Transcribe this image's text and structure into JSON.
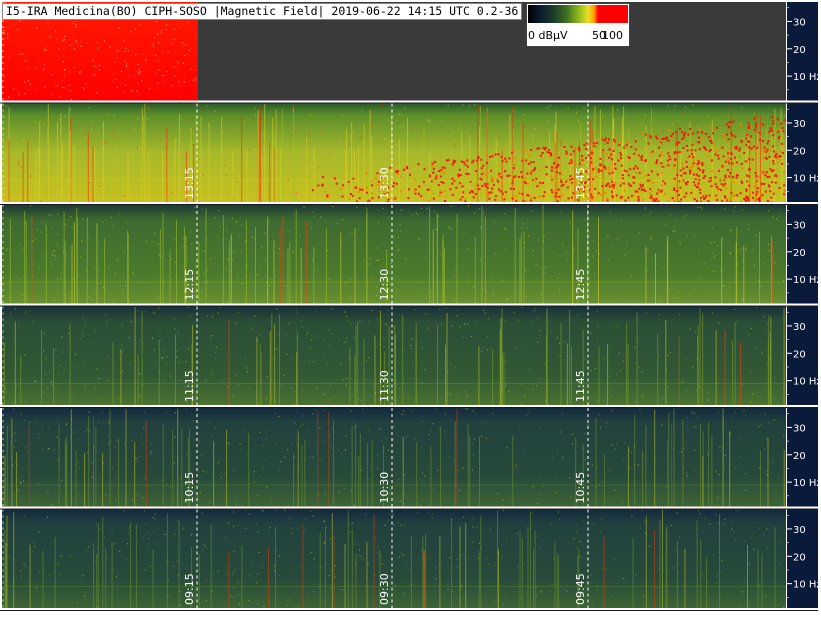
{
  "title": "I5-IRA Medicina(BO) CIPH-SOSO |Magnetic Field| 2019-06-22 14:15 UTC 0.2-36",
  "legend": {
    "unit_label": "0 dBµV",
    "mid_label": "50",
    "max_label": "100"
  },
  "colors": {
    "background": "#ffffff",
    "axis_bg": "#0a1a3a",
    "gap": "#3a3a3a",
    "peak": "#ff0000"
  },
  "chart_data": {
    "type": "heatmap",
    "title": "I5-IRA Medicina(BO) CIPH-SOSO |Magnetic Field| 2019-06-22 14:15 UTC 0.2-36",
    "ylabel": "Hz",
    "ylim": [
      0,
      36
    ],
    "y_ticks": [
      "30",
      "20",
      "10 Hz"
    ],
    "color_scale": {
      "min": 0,
      "max": 100,
      "unit": "dBµV",
      "ticks": [
        "0",
        "50",
        "100"
      ]
    },
    "rows": [
      {
        "time_ticks": [],
        "intensity": "red-full",
        "data_end_fraction": 0.25
      },
      {
        "time_ticks": [
          "13:15",
          "13:30",
          "13:45"
        ],
        "intensity": "very-high",
        "data_end_fraction": 1.0
      },
      {
        "time_ticks": [
          "12:15",
          "12:30",
          "12:45"
        ],
        "intensity": "medium",
        "data_end_fraction": 1.0
      },
      {
        "time_ticks": [
          "11:15",
          "11:30",
          "11:45"
        ],
        "intensity": "medium-low",
        "data_end_fraction": 1.0
      },
      {
        "time_ticks": [
          "10:15",
          "10:30",
          "10:45"
        ],
        "intensity": "low",
        "data_end_fraction": 1.0
      },
      {
        "time_ticks": [
          "09:15",
          "09:30",
          "09:45"
        ],
        "intensity": "low",
        "data_end_fraction": 1.0
      }
    ]
  }
}
